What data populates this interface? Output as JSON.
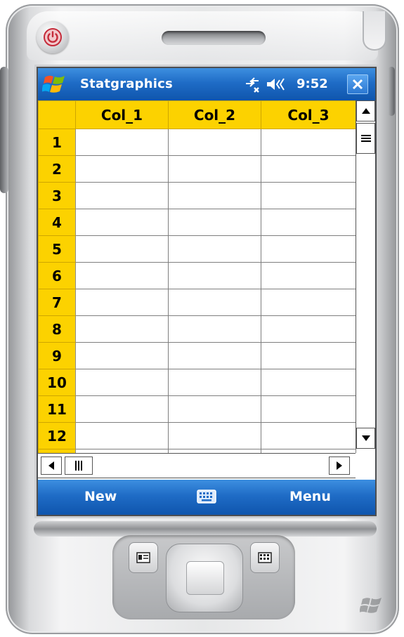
{
  "device": {
    "power_icon": "power-icon",
    "windows_logo": "windows-logo"
  },
  "titlebar": {
    "start_icon": "windows-flag-icon",
    "title": "Statgraphics",
    "connectivity_icon": "connectivity-icon",
    "volume_icon": "speaker-muted-icon",
    "time": "9:52",
    "close_icon": "close-icon",
    "color": "#1f6cc6"
  },
  "grid": {
    "header_color": "#fcd200",
    "columns": [
      "Col_1",
      "Col_2",
      "Col_3"
    ],
    "rows": [
      "1",
      "2",
      "3",
      "4",
      "5",
      "6",
      "7",
      "8",
      "9",
      "10",
      "11",
      "12"
    ]
  },
  "softkeys": {
    "left": "New",
    "center_icon": "keyboard-icon",
    "right": "Menu"
  }
}
